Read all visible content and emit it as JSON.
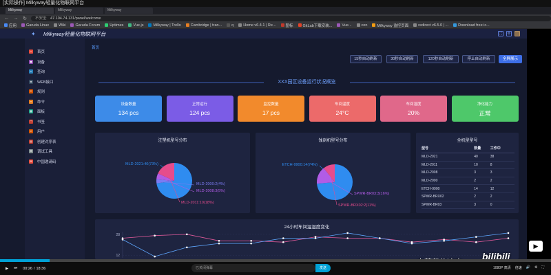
{
  "video": {
    "title": "[实际操作] Milkyway轻量化物联网平台",
    "time_current": "00:26",
    "time_total": "18:36",
    "danmaku_placeholder": "已关闭弹幕",
    "danmaku_send": "发送",
    "quality": "1080P 高清",
    "speed_label": "倍速",
    "uploader_watermark": "史蒂芬的速度",
    "site_logo": "bilibili"
  },
  "browser": {
    "tabs": [
      {
        "label": "Milkyway",
        "active": true
      },
      {
        "label": "Milkyway",
        "active": false
      },
      {
        "label": "Milkyway",
        "active": false
      }
    ],
    "back": "←",
    "forward": "→",
    "reload": "↻",
    "security_label": "不安全",
    "url": "47.104.74.131/panel/welcome",
    "bookmarks": [
      {
        "label": "应用",
        "color": "#4a8af4"
      },
      {
        "label": "Garuda Linux",
        "color": "#9b59b6"
      },
      {
        "label": "Wiki",
        "color": "#888888"
      },
      {
        "label": "Garuda Forum",
        "color": "#9b59b6"
      },
      {
        "label": "Uptimes",
        "color": "#2ecc71"
      },
      {
        "label": "Vue.js",
        "color": "#42b883"
      },
      {
        "label": "Milkyway | Trello",
        "color": "#0079bf"
      },
      {
        "label": "Cambridge | tran...",
        "color": "#e67e22"
      },
      {
        "label": "q",
        "color": "#555555"
      },
      {
        "label": "Home v6.4.1 | Re...",
        "color": "#888888"
      },
      {
        "label": "图标",
        "color": "#c0392b"
      },
      {
        "label": "GitLab下载安装...",
        "color": "#e24329"
      },
      {
        "label": "Vue...",
        "color": "#9b59b6"
      },
      {
        "label": "con",
        "color": "#888888"
      },
      {
        "label": "Milkyway 监控页面",
        "color": "#f39c12"
      },
      {
        "label": "redirect v6.5.0 | ...",
        "color": "#888888"
      },
      {
        "label": "Download free ic...",
        "color": "#3498db"
      }
    ]
  },
  "app": {
    "title": "Milkyway轻量化物联网平台",
    "breadcrumb": "首页",
    "sidebar": [
      {
        "label": "首页",
        "icon": "home-icon",
        "color": "#e74c3c",
        "glyph": "⌂"
      },
      {
        "label": "设备",
        "icon": "device-icon",
        "color": "#8e44ad",
        "glyph": "▣"
      },
      {
        "label": "查询",
        "icon": "search-icon",
        "color": "#2980b9",
        "glyph": "⌕"
      },
      {
        "label": "WEB接口",
        "icon": "web-icon",
        "color": "#34495e",
        "glyph": "◈"
      },
      {
        "label": "规则",
        "icon": "rule-icon",
        "color": "#d35400",
        "glyph": "≡"
      },
      {
        "label": "命令",
        "icon": "command-icon",
        "color": "#e67e22",
        "glyph": "»"
      },
      {
        "label": "面板",
        "icon": "panel-icon",
        "color": "#16a085",
        "glyph": "▦"
      },
      {
        "label": "书签",
        "icon": "bookmark-icon",
        "color": "#c0392b",
        "glyph": "❐"
      },
      {
        "label": "用户",
        "icon": "user-icon",
        "color": "#d35400",
        "glyph": "☺"
      },
      {
        "label": "创建对序表",
        "icon": "table-icon",
        "color": "#c0392b",
        "glyph": "▤"
      },
      {
        "label": "调试工具",
        "icon": "debug-icon",
        "color": "#7f8c8d",
        "glyph": "⚙"
      },
      {
        "label": "中国邀请码",
        "icon": "invite-icon",
        "color": "#e74c3c",
        "glyph": "✉"
      }
    ],
    "refresh_buttons": [
      {
        "label": "15秒自动刷新"
      },
      {
        "label": "30秒自动刷新"
      },
      {
        "label": "120秒自动刷新"
      },
      {
        "label": "停止自动刷新"
      },
      {
        "label": "全屏展示"
      }
    ],
    "section_title": "XXX园区设备运行状况概览",
    "stat_cards": [
      {
        "label": "设备数量",
        "value": "134 pcs",
        "color": "#3d8be8"
      },
      {
        "label": "正常运行",
        "value": "124 pcs",
        "color": "#7b5ce6"
      },
      {
        "label": "监控数量",
        "value": "17 pcs",
        "color": "#f28a2c"
      },
      {
        "label": "车间温度",
        "value": "24°C",
        "color": "#ec6a6a"
      },
      {
        "label": "车间湿度",
        "value": "20%",
        "color": "#e0688a"
      },
      {
        "label": "净化能力",
        "value": "正常",
        "color": "#4ec86a"
      }
    ],
    "pie1": {
      "title": "注塑机型号分布",
      "slices": [
        {
          "label": "MLD-2021:40(73%)",
          "value": 40,
          "color": "#2f8cf0"
        },
        {
          "label": "MLD-2000:2(4%)",
          "value": 2,
          "color": "#7b7bf2"
        },
        {
          "label": "MLD-2008:3(5%)",
          "value": 3,
          "color": "#b15ce6"
        },
        {
          "label": "MLD-2011:10(18%)",
          "value": 10,
          "color": "#e64c8c"
        }
      ]
    },
    "pie2": {
      "title": "蚀刻机型号分布",
      "slices": [
        {
          "label": "ETCH-9900:14(74%)",
          "value": 14,
          "color": "#2f8cf0"
        },
        {
          "label": "SPWR-BR03:3(16%)",
          "value": 3,
          "color": "#b15ce6"
        },
        {
          "label": "SPWR-BRX02:2(11%)",
          "value": 2,
          "color": "#e64c8c"
        }
      ]
    },
    "model_table": {
      "title": "全机型型号",
      "headers": [
        "型号",
        "数量",
        "工作中"
      ],
      "rows": [
        [
          "MLD-2021",
          "40",
          "38"
        ],
        [
          "MLD-2011",
          "10",
          "8"
        ],
        [
          "MLD-2008",
          "3",
          "3"
        ],
        [
          "MLD-2000",
          "2",
          "2"
        ],
        [
          "ETCH-9900",
          "14",
          "12"
        ],
        [
          "SPWR-BRX02",
          "2",
          "2"
        ],
        [
          "SPWR-BR03",
          "3",
          "0"
        ]
      ]
    },
    "line_chart": {
      "title": "24小时车间温湿度变化",
      "y_ticks": [
        "28",
        "12"
      ],
      "ylim": [
        10,
        30
      ],
      "series": [
        {
          "color": "#e05a9a",
          "values": [
            25,
            27,
            28,
            23,
            23,
            22,
            26,
            25,
            25,
            22,
            24,
            22,
            25
          ]
        },
        {
          "color": "#5fa8ff",
          "values": [
            24,
            11,
            18,
            21,
            21,
            25,
            25,
            29,
            25,
            21,
            23,
            26,
            29
          ]
        }
      ]
    }
  }
}
